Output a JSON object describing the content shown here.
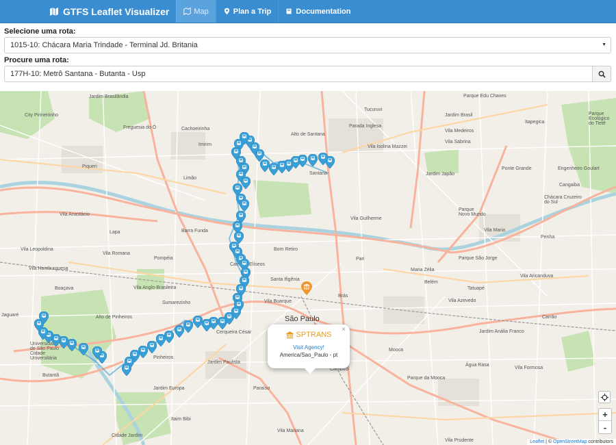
{
  "navbar": {
    "brand": "GTFS Leaflet Visualizer",
    "items": [
      {
        "label": "Map",
        "icon": "map-icon",
        "active": true
      },
      {
        "label": "Plan a Trip",
        "icon": "map-pin-icon",
        "active": false
      },
      {
        "label": "Documentation",
        "icon": "book-icon",
        "active": false
      }
    ]
  },
  "form": {
    "route_label": "Selecione uma rota:",
    "route_selected": "1015-10: Chácara Maria Trindade - Terminal Jd. Britania",
    "search_label": "Procure uma rota:",
    "search_value": "177H-10: Metrô Santana - Butanta - Usp"
  },
  "popup": {
    "title": "SPTRANS",
    "link": "Visit Agency!",
    "timezone": "America/Sao_Paulo - pt",
    "close": "×"
  },
  "map": {
    "labels": [
      "Jardim Brasilândia",
      "City Pirineirinho",
      "Freguesia do Ó",
      "Cachoeirinha",
      "Imirim",
      "Alto de Santana",
      "Tucuruvi",
      "Jardim Brasil",
      "Parada Inglesa",
      "Vila Isolina Mazzei",
      "Vila Medeiros",
      "Vila Sabrina",
      "Parque Edu Chaves",
      "Itapegica",
      "Parque Ecológico do Tietê",
      "Piqueri",
      "Limão",
      "Santana",
      "Jardim Japão",
      "Ponte Grande",
      "Engenheiro Goulart",
      "Vila Anastácio",
      "Vila Guilherme",
      "Parque Novo Mundo",
      "Vila Maria",
      "Cangaiba",
      "Lapa",
      "Barra Funda",
      "Pari",
      "Parque São Jorge",
      "Penha",
      "Vila Leopoldina",
      "Vila Romana",
      "Pompéia",
      "Bom Retiro",
      "Belém",
      "Maria Zélia",
      "Vila Aricanduva",
      "Vila Hamburguesa",
      "Boaçava",
      "Vila Anglo-Brasileira",
      "Sumarezinho",
      "Vila Buarque",
      "Brás",
      "Tatuapé",
      "Vila Azevedo",
      "Alto de Pinheiros",
      "Jaguaré",
      "São Paulo",
      "Carrão",
      "Jardim Anália Franco",
      "Pinheiros",
      "Cerqueira César",
      "Jardim Paulista",
      "Liberdade",
      "Cambuci",
      "Mooca",
      "Vila Formosa",
      "Butantã",
      "Jardim Europa",
      "Paraíso",
      "Parque da Mooca",
      "Água Rasa",
      "Itaim Bibi",
      "Cidade Jardim",
      "Vila Mariana",
      "Vila Prudente",
      "Santa Ifigênia",
      "Campos Elíseos",
      "Universidade de São Paulo Cidade Universitária",
      "Chácara Cruzeiro do Sul"
    ]
  },
  "controls": {
    "locate": "crosshair-icon",
    "zoom_in": "+",
    "zoom_out": "-"
  },
  "attribution": {
    "leaflet": "Leaflet",
    "separator": "| ©",
    "osm": "OpenStreetMap",
    "contributors": "contributors"
  },
  "colors": {
    "navbar": "#3a8dd0",
    "marker": "#3a9fd6",
    "agency_marker": "#f0962e",
    "popup_title": "#e89b21"
  }
}
